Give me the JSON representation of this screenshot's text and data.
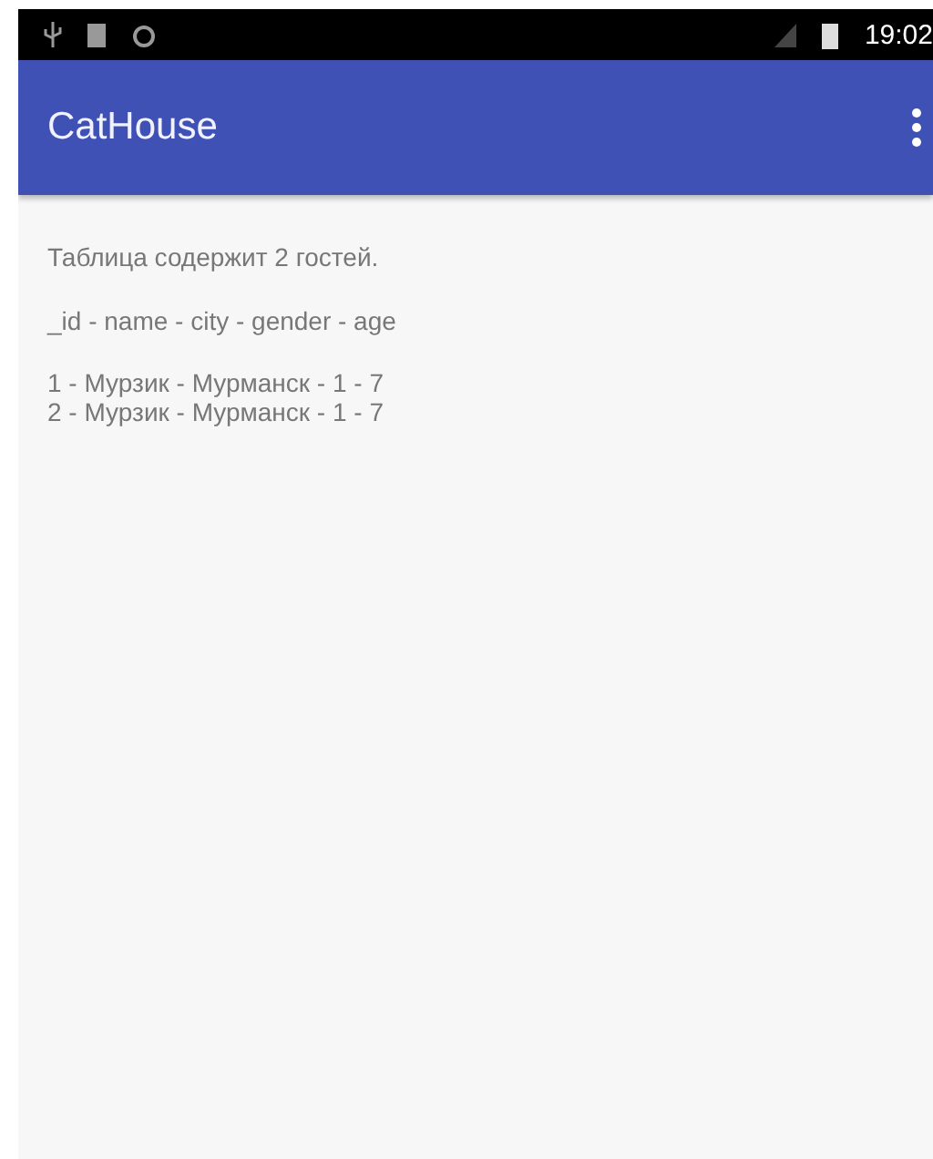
{
  "status_bar": {
    "time": "19:02"
  },
  "app_bar": {
    "title": "CatHouse"
  },
  "content": {
    "summary": "Таблица содержит 2 гостей.",
    "header": "_id - name - city - gender - age",
    "rows": [
      "1 - Мурзик - Мурманск - 1 - 7",
      "2 - Мурзик - Мурманск - 1 - 7"
    ]
  }
}
